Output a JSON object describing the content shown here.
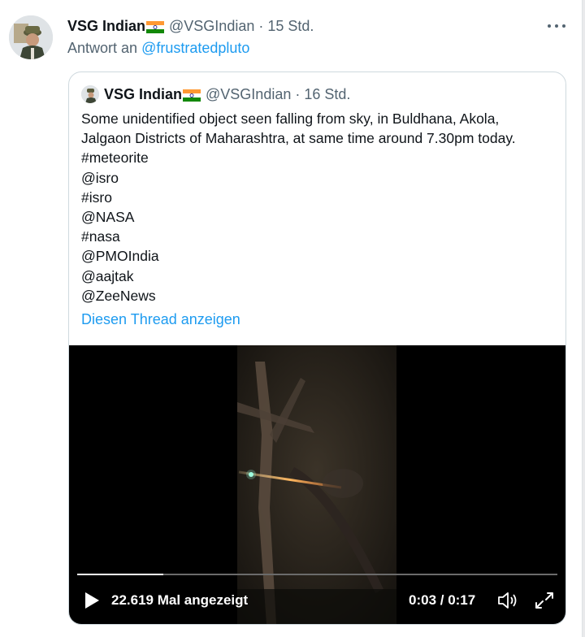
{
  "tweet": {
    "author_name": "VSG Indian",
    "author_handle": "@VSGIndian",
    "separator": "·",
    "time": "15 Std.",
    "reply_prefix": "Antwort an",
    "reply_to": "@frustratedpluto"
  },
  "quoted": {
    "author_name": "VSG Indian",
    "author_handle": "@VSGIndian",
    "separator": "·",
    "time": "16 Std.",
    "text_lines": [
      "Some unidentified object seen falling from sky, in Buldhana, Akola,",
      "Jalgaon Districts of Maharashtra, at same time around 7.30pm today.",
      "#meteorite",
      "@isro",
      "#isro",
      "@NASA",
      "#nasa",
      "@PMOIndia",
      "@aajtak",
      "@ZeeNews"
    ],
    "show_thread": "Diesen Thread anzeigen"
  },
  "video": {
    "views": "22.619 Mal angezeigt",
    "time": "0:03 / 0:17",
    "progress": 0.18
  },
  "icons": [
    "more-icon",
    "flag-icon",
    "play-icon",
    "volume-icon",
    "fullscreen-icon"
  ],
  "colors": {
    "link": "#1d9bf0",
    "muted": "#536471",
    "border": "#cfd9de"
  }
}
